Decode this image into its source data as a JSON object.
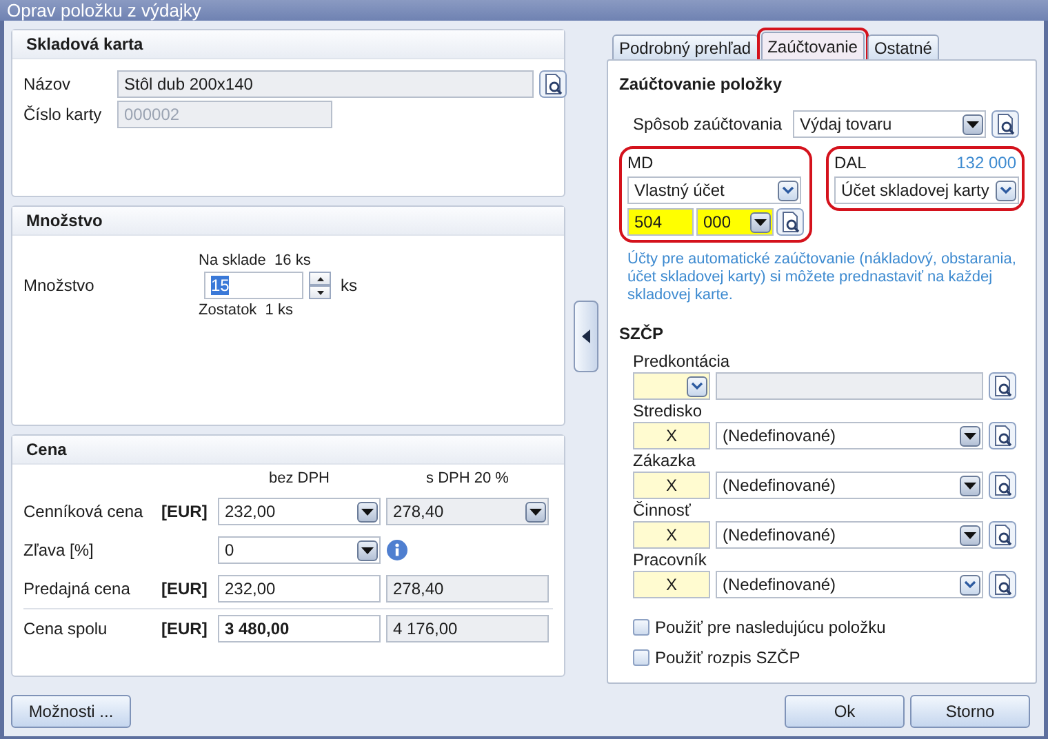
{
  "window": {
    "title": "Oprav položku z výdajky"
  },
  "card": {
    "title": "Skladová karta",
    "name_label": "Názov",
    "name": "Stôl dub 200x140",
    "number_label": "Číslo karty",
    "number": "000002"
  },
  "quantity": {
    "title": "Množstvo",
    "label": "Množstvo",
    "stock": "Na sklade  16 ks",
    "value": "15",
    "unit": "ks",
    "remaining": "Zostatok  1 ks"
  },
  "price": {
    "title": "Cena",
    "columns": [
      "bez DPH",
      "s DPH 20 %"
    ],
    "rows": [
      {
        "kind": "list",
        "label": "Cenníková cena",
        "currency": "[EUR]",
        "net": "232,00",
        "gross": "278,40"
      },
      {
        "kind": "discount",
        "label": "Zľava [%]",
        "net": "0"
      },
      {
        "kind": "plain",
        "label": "Predajná cena",
        "currency": "[EUR]",
        "net": "232,00",
        "gross": "278,40"
      },
      {
        "kind": "total",
        "label": "Cena spolu",
        "currency": "[EUR]",
        "net": "3 480,00",
        "gross": "4 176,00"
      }
    ]
  },
  "tabs": [
    {
      "label": "Podrobný prehľad",
      "selected": false,
      "highlighted": false
    },
    {
      "label": "Zaúčtovanie",
      "selected": true,
      "highlighted": true
    },
    {
      "label": "Ostatné",
      "selected": false,
      "highlighted": false
    }
  ],
  "posting": {
    "title": "Zaúčtovanie položky",
    "method_label": "Spôsob zaúčtovania",
    "method": "Výdaj tovaru",
    "md": {
      "label": "MD",
      "type": "Vlastný účet",
      "account": "504",
      "analytic": "000",
      "highlighted": true
    },
    "dal": {
      "label": "DAL",
      "account": "132 000",
      "type": "Účet skladovej karty",
      "highlighted": true
    },
    "note": "Účty pre automatické zaúčtovanie (nákladový, obstarania, účet skladovej karty) si môžete prednastaviť na každej skladovej karte."
  },
  "szcp": {
    "title": "SZČP",
    "preset_label": "Predkontácia",
    "rows": [
      {
        "label": "Stredisko",
        "code": "X",
        "value": "(Nedefinované)",
        "kind": "dark"
      },
      {
        "label": "Zákazka",
        "code": "X",
        "value": "(Nedefinované)",
        "kind": "dark"
      },
      {
        "label": "Činnosť",
        "code": "X",
        "value": "(Nedefinované)",
        "kind": "dark"
      },
      {
        "label": "Pracovník",
        "code": "X",
        "value": "(Nedefinované)",
        "kind": "light"
      }
    ],
    "checkboxes": [
      {
        "label": "Použiť pre nasledujúcu položku",
        "checked": false
      },
      {
        "label": "Použiť rozpis SZČP",
        "checked": false
      }
    ]
  },
  "buttons": {
    "options": "Možnosti ...",
    "ok": "Ok",
    "cancel": "Storno"
  }
}
